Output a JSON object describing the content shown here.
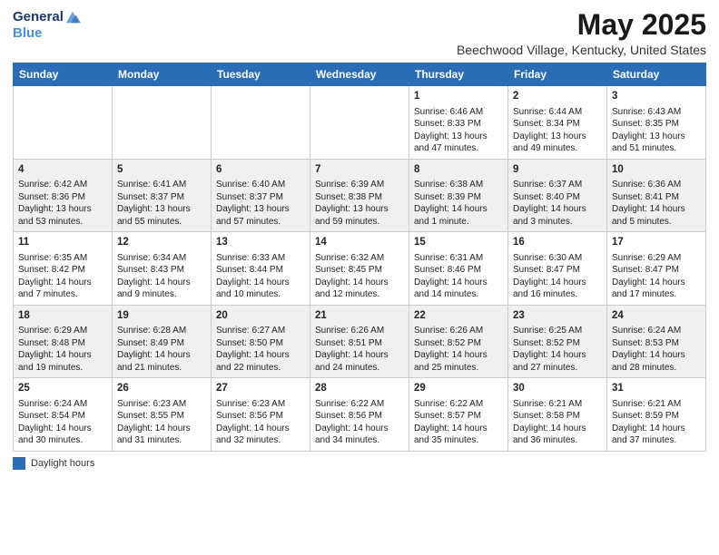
{
  "header": {
    "logo_line1": "General",
    "logo_line2": "Blue",
    "title": "May 2025",
    "subtitle": "Beechwood Village, Kentucky, United States"
  },
  "legend": {
    "label": "Daylight hours"
  },
  "days_of_week": [
    "Sunday",
    "Monday",
    "Tuesday",
    "Wednesday",
    "Thursday",
    "Friday",
    "Saturday"
  ],
  "weeks": [
    [
      {
        "day": "",
        "info": ""
      },
      {
        "day": "",
        "info": ""
      },
      {
        "day": "",
        "info": ""
      },
      {
        "day": "",
        "info": ""
      },
      {
        "day": "1",
        "info": "Sunrise: 6:46 AM\nSunset: 8:33 PM\nDaylight: 13 hours and 47 minutes."
      },
      {
        "day": "2",
        "info": "Sunrise: 6:44 AM\nSunset: 8:34 PM\nDaylight: 13 hours and 49 minutes."
      },
      {
        "day": "3",
        "info": "Sunrise: 6:43 AM\nSunset: 8:35 PM\nDaylight: 13 hours and 51 minutes."
      }
    ],
    [
      {
        "day": "4",
        "info": "Sunrise: 6:42 AM\nSunset: 8:36 PM\nDaylight: 13 hours and 53 minutes."
      },
      {
        "day": "5",
        "info": "Sunrise: 6:41 AM\nSunset: 8:37 PM\nDaylight: 13 hours and 55 minutes."
      },
      {
        "day": "6",
        "info": "Sunrise: 6:40 AM\nSunset: 8:37 PM\nDaylight: 13 hours and 57 minutes."
      },
      {
        "day": "7",
        "info": "Sunrise: 6:39 AM\nSunset: 8:38 PM\nDaylight: 13 hours and 59 minutes."
      },
      {
        "day": "8",
        "info": "Sunrise: 6:38 AM\nSunset: 8:39 PM\nDaylight: 14 hours and 1 minute."
      },
      {
        "day": "9",
        "info": "Sunrise: 6:37 AM\nSunset: 8:40 PM\nDaylight: 14 hours and 3 minutes."
      },
      {
        "day": "10",
        "info": "Sunrise: 6:36 AM\nSunset: 8:41 PM\nDaylight: 14 hours and 5 minutes."
      }
    ],
    [
      {
        "day": "11",
        "info": "Sunrise: 6:35 AM\nSunset: 8:42 PM\nDaylight: 14 hours and 7 minutes."
      },
      {
        "day": "12",
        "info": "Sunrise: 6:34 AM\nSunset: 8:43 PM\nDaylight: 14 hours and 9 minutes."
      },
      {
        "day": "13",
        "info": "Sunrise: 6:33 AM\nSunset: 8:44 PM\nDaylight: 14 hours and 10 minutes."
      },
      {
        "day": "14",
        "info": "Sunrise: 6:32 AM\nSunset: 8:45 PM\nDaylight: 14 hours and 12 minutes."
      },
      {
        "day": "15",
        "info": "Sunrise: 6:31 AM\nSunset: 8:46 PM\nDaylight: 14 hours and 14 minutes."
      },
      {
        "day": "16",
        "info": "Sunrise: 6:30 AM\nSunset: 8:47 PM\nDaylight: 14 hours and 16 minutes."
      },
      {
        "day": "17",
        "info": "Sunrise: 6:29 AM\nSunset: 8:47 PM\nDaylight: 14 hours and 17 minutes."
      }
    ],
    [
      {
        "day": "18",
        "info": "Sunrise: 6:29 AM\nSunset: 8:48 PM\nDaylight: 14 hours and 19 minutes."
      },
      {
        "day": "19",
        "info": "Sunrise: 6:28 AM\nSunset: 8:49 PM\nDaylight: 14 hours and 21 minutes."
      },
      {
        "day": "20",
        "info": "Sunrise: 6:27 AM\nSunset: 8:50 PM\nDaylight: 14 hours and 22 minutes."
      },
      {
        "day": "21",
        "info": "Sunrise: 6:26 AM\nSunset: 8:51 PM\nDaylight: 14 hours and 24 minutes."
      },
      {
        "day": "22",
        "info": "Sunrise: 6:26 AM\nSunset: 8:52 PM\nDaylight: 14 hours and 25 minutes."
      },
      {
        "day": "23",
        "info": "Sunrise: 6:25 AM\nSunset: 8:52 PM\nDaylight: 14 hours and 27 minutes."
      },
      {
        "day": "24",
        "info": "Sunrise: 6:24 AM\nSunset: 8:53 PM\nDaylight: 14 hours and 28 minutes."
      }
    ],
    [
      {
        "day": "25",
        "info": "Sunrise: 6:24 AM\nSunset: 8:54 PM\nDaylight: 14 hours and 30 minutes."
      },
      {
        "day": "26",
        "info": "Sunrise: 6:23 AM\nSunset: 8:55 PM\nDaylight: 14 hours and 31 minutes."
      },
      {
        "day": "27",
        "info": "Sunrise: 6:23 AM\nSunset: 8:56 PM\nDaylight: 14 hours and 32 minutes."
      },
      {
        "day": "28",
        "info": "Sunrise: 6:22 AM\nSunset: 8:56 PM\nDaylight: 14 hours and 34 minutes."
      },
      {
        "day": "29",
        "info": "Sunrise: 6:22 AM\nSunset: 8:57 PM\nDaylight: 14 hours and 35 minutes."
      },
      {
        "day": "30",
        "info": "Sunrise: 6:21 AM\nSunset: 8:58 PM\nDaylight: 14 hours and 36 minutes."
      },
      {
        "day": "31",
        "info": "Sunrise: 6:21 AM\nSunset: 8:59 PM\nDaylight: 14 hours and 37 minutes."
      }
    ]
  ]
}
